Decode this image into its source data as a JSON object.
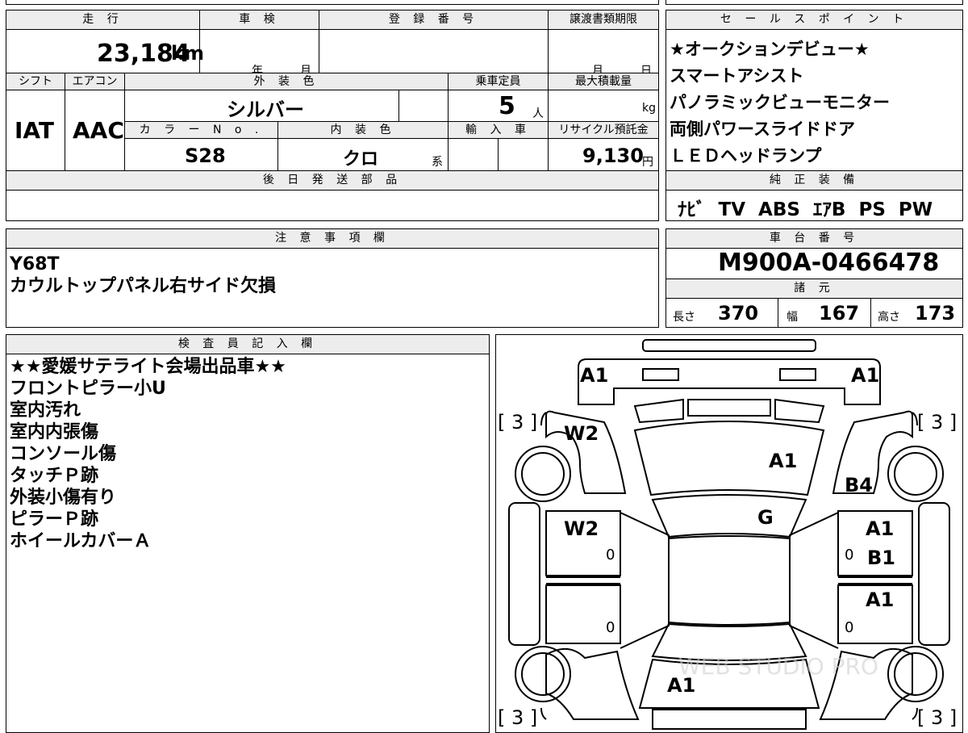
{
  "header": {
    "mileage_label": "走 行",
    "inspection_label": "車 検",
    "registration_label": "登 録 番 号",
    "deadline_label": "譲渡書類期限",
    "sales_points_label": "セ ー ル ス ポ イ ン ト",
    "mileage_value": "23,184",
    "mileage_unit": "km",
    "inspection_year_unit": "年",
    "inspection_month_unit": "月",
    "deadline_month_unit": "月",
    "deadline_day_unit": "日"
  },
  "specs": {
    "shift_label": "シフト",
    "aircon_label": "エアコン",
    "exterior_color_label": "外 装 色",
    "capacity_label": "乗車定員",
    "max_load_label": "最大積載量",
    "shift_value": "IAT",
    "aircon_value": "AAC",
    "exterior_color_value": "シルバー",
    "capacity_value": "5",
    "capacity_unit": "人",
    "max_load_unit": "kg",
    "color_no_label": "カ ラ ー N o .",
    "interior_color_label": "内 装 色",
    "import_label": "輸 入 車",
    "recycle_label": "リサイクル預託金",
    "color_no_value": "S28",
    "interior_color_value": "クロ",
    "interior_color_unit": "系",
    "recycle_value": "9,130",
    "recycle_unit": "円",
    "later_parts_label": "後 日 発 送 部 品"
  },
  "sales_points": {
    "items": [
      "★オークションデビュー★",
      "スマートアシスト",
      "パノラミックビューモニター",
      "両側パワースライドドア",
      "ＬＥＤヘッドランプ"
    ]
  },
  "equipment": {
    "label": "純 正 装 備",
    "value": "ﾅﾋﾞ  TV  ABS  ｴｱB  PS  PW"
  },
  "notes": {
    "label": "注 意 事 項 欄",
    "lines": [
      "Y68T",
      "カウルトップパネル右サイド欠損"
    ]
  },
  "chassis": {
    "label": "車 台 番 号",
    "value": "M900A-0466478",
    "dimensions_label": "諸 元",
    "length_label": "長さ",
    "length_value": "370",
    "width_label": "幅",
    "width_value": "167",
    "height_label": "高さ",
    "height_value": "173"
  },
  "inspector": {
    "label": "検 査 員 記 入 欄",
    "lines": [
      "★★愛媛サテライト会場出品車★★",
      "フロントピラー小U",
      "室内汚れ",
      "室内内張傷",
      "コンソール傷",
      "タッチＰ跡",
      "外装小傷有り",
      "ピラーＰ跡",
      "ホイールカバーＡ"
    ]
  },
  "diagram": {
    "front_left": "A1",
    "front_right": "A1",
    "tire_fl": "[ 3 ]",
    "tire_fr": "[ 3 ]",
    "tire_rl": "[ 3 ]",
    "tire_rr": "[ 3 ]",
    "fender_left": "W2",
    "hood": "A1",
    "fender_right": "B4",
    "windshield": "G",
    "door_fl": "W2",
    "door_fr_1": "A1",
    "door_fr_2": "B1",
    "door_rr": "A1",
    "rear": "A1",
    "mark_1": "0",
    "mark_2": "0",
    "mark_3": "0",
    "mark_4": "0",
    "watermark": "WEB STUDIO PRO"
  }
}
